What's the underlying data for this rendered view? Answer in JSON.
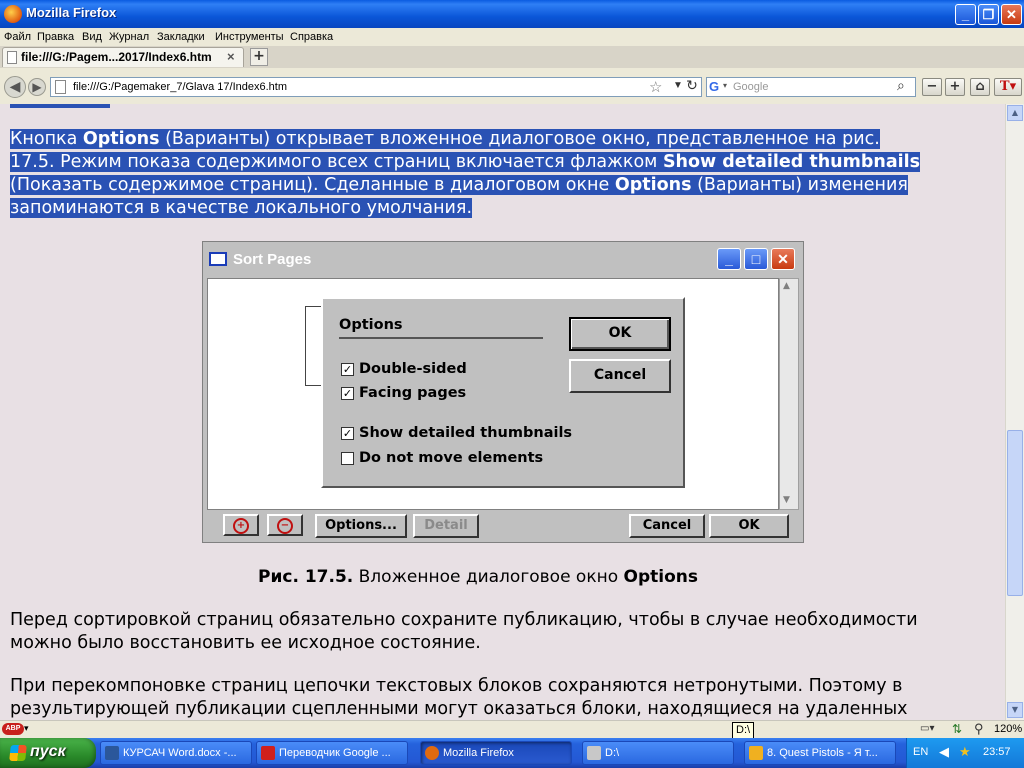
{
  "window": {
    "title": "Mozilla Firefox"
  },
  "menu": [
    "Файл",
    "Правка",
    "Вид",
    "Журнал",
    "Закладки",
    "Инструменты",
    "Справка"
  ],
  "tab": {
    "label": "file:///G:/Pagem...2017/Index6.htm",
    "new_tab": "+",
    "close": "×"
  },
  "nav": {
    "url": "file:///G:/Pagemaker_7/Glava 17/Index6.htm",
    "search_placeholder": "Google",
    "zoom_out": "−",
    "zoom_in": "+"
  },
  "content": {
    "p1": {
      "t1": "Кнопка ",
      "b1": "Options",
      "t2": " (Варианты) открывает вложенное диалоговое окно, представленное на рис.",
      "t3": "17.5. Режим показа содержимого всех страниц включается флажком ",
      "b2": "Show detailed thumbnails",
      "t4": "(Показать содержимое страниц). Сделанные в диалоговом окне ",
      "b3": "Options",
      "t5": " (Варианты) изменения",
      "t6": "запоминаются в качестве локального умолчания."
    },
    "figure": {
      "window_title": "Sort Pages",
      "options_title": "Options",
      "options": [
        {
          "label": "Double-sided",
          "checked": true
        },
        {
          "label": "Facing pages",
          "checked": true
        },
        {
          "label": "Show detailed thumbnails",
          "checked": true
        },
        {
          "label": "Do not move elements",
          "checked": false
        }
      ],
      "ok": "OK",
      "cancel": "Cancel",
      "bottom_options": "Options...",
      "bottom_detail": "Detail",
      "bottom_cancel": "Cancel",
      "bottom_ok": "OK"
    },
    "caption_bold": "Рис. 17.5.",
    "caption_text": " Вложенное диалоговое окно ",
    "caption_bold2": "Options",
    "p2_l1": "Перед сортировкой страниц обязательно сохраните публикацию, чтобы в случае необходимости",
    "p2_l2": "можно было восстановить ее исходное состояние.",
    "p3_l1": "При перекомпоновке страниц цепочки текстовых блоков сохраняются нетронутыми. Поэтому в",
    "p3_l2": "результирующей публикации сцепленными могут оказаться блоки, находящиеся на удаленных"
  },
  "statusbar": {
    "tooltip": "D:\\",
    "zoom": "120%",
    "adblock": "ABP"
  },
  "taskbar": {
    "start": "пуск",
    "tasks": [
      {
        "label": "КУРСАЧ Word.docx -...",
        "color": "#2b579a"
      },
      {
        "label": "Переводчик Google ...",
        "color": "#d0201c"
      },
      {
        "label": "Mozilla Firefox",
        "color": "#e06a10"
      },
      {
        "label": "D:\\",
        "color": "#c8c8c8"
      },
      {
        "label": "8. Quest Pistols - Я т...",
        "color": "#f0b020"
      }
    ],
    "lang": "EN",
    "clock": "23:57"
  }
}
